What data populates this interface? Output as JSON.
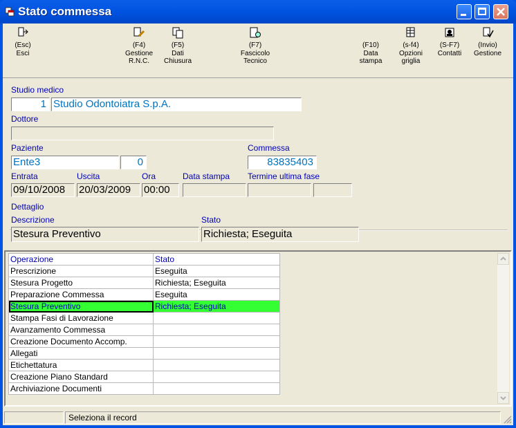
{
  "window": {
    "title": "Stato commessa"
  },
  "toolbar": [
    {
      "id": "esc",
      "line1": "(Esc)",
      "line2": "Esci",
      "line3": "",
      "icon": "exit-door-icon"
    },
    {
      "id": "f4",
      "line1": "(F4)",
      "line2": "Gestione",
      "line3": "R.N.C.",
      "icon": "edit-document-icon"
    },
    {
      "id": "f5",
      "line1": "(F5)",
      "line2": "Dati",
      "line3": "Chiusura",
      "icon": "documents-icon"
    },
    {
      "id": "f7",
      "line1": "(F7)",
      "line2": "Fascicolo",
      "line3": "Tecnico",
      "icon": "clipboard-search-icon"
    },
    {
      "id": "f10",
      "line1": "(F10)",
      "line2": "Data",
      "line3": "stampa",
      "icon": ""
    },
    {
      "id": "sf4",
      "line1": "(s-f4)",
      "line2": "Opzioni",
      "line3": "griglia",
      "icon": "grid-options-icon"
    },
    {
      "id": "sf7",
      "line1": "(S-F7)",
      "line2": "Contatti",
      "line3": "",
      "icon": "contacts-icon"
    },
    {
      "id": "invio",
      "line1": "(Invio)",
      "line2": "Gestione",
      "line3": "",
      "icon": "edit-check-icon"
    }
  ],
  "form": {
    "studio_label": "Studio medico",
    "studio_code": "1",
    "studio_name": "Studio Odontoiatra S.p.A.",
    "dottore_label": "Dottore",
    "dottore_value": "",
    "paziente_label": "Paziente",
    "paziente_name": "Ente3",
    "paziente_code": "0",
    "commessa_label": "Commessa",
    "commessa_value": "83835403",
    "entrata_label": "Entrata",
    "entrata_value": "09/10/2008",
    "uscita_label": "Uscita",
    "uscita_value": "20/03/2009",
    "ora_label": "Ora",
    "ora_value": "00:00",
    "data_stampa_label": "Data stampa",
    "data_stampa_value": "",
    "termine_label": "Termine ultima fase",
    "termine_value1": "",
    "termine_value2": ""
  },
  "dettaglio": {
    "group_label": "Dettaglio",
    "descrizione_label": "Descrizione",
    "descrizione_value": "Stesura Preventivo",
    "stato_label": "Stato",
    "stato_value": "Richiesta; Eseguita"
  },
  "grid": {
    "headers": [
      "Operazione",
      "Stato"
    ],
    "selected_index": 3,
    "rows": [
      [
        "Prescrizione",
        "Eseguita"
      ],
      [
        "Stesura Progetto",
        "Richiesta; Eseguita"
      ],
      [
        "Preparazione Commessa",
        "Eseguita"
      ],
      [
        "Stesura Preventivo",
        "Richiesta; Eseguita"
      ],
      [
        "Stampa Fasi di Lavorazione",
        ""
      ],
      [
        "Avanzamento Commessa",
        ""
      ],
      [
        "Creazione Documento Accomp.",
        ""
      ],
      [
        "Allegati",
        ""
      ],
      [
        "Etichettatura",
        ""
      ],
      [
        "Creazione Piano Standard",
        ""
      ],
      [
        "Archiviazione Documenti",
        ""
      ]
    ]
  },
  "status": {
    "text": "Seleziona il record"
  }
}
